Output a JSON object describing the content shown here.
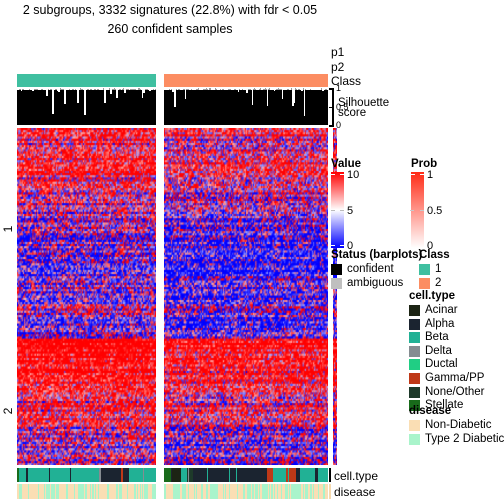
{
  "title": {
    "main": "2 subgroups, 3332 signatures (22.8%) with fdr < 0.05",
    "sub": "260 confident samples"
  },
  "annotations": {
    "p1_label": "p1",
    "p2_label": "p2",
    "class_label": "Class",
    "silhouette_label_line1": "Silhouette",
    "silhouette_label_line2": "score",
    "cell_type_label": "cell.type",
    "disease_label": "disease"
  },
  "silhouette_axis": {
    "ticks": [
      "1",
      "0.5",
      "0"
    ],
    "values": [
      1,
      0.5,
      0
    ]
  },
  "row_labels": [
    "1",
    "2"
  ],
  "legends": {
    "value": {
      "title": "Value",
      "ticks": [
        "10",
        "5",
        "0"
      ],
      "min": 0,
      "mid": 5,
      "max": 10,
      "low_color": "#0000FF",
      "mid_color": "#FFFFFF",
      "high_color": "#FF0000"
    },
    "prob": {
      "title": "Prob",
      "ticks": [
        "1",
        "0.5",
        "0"
      ],
      "min": 0,
      "max": 1,
      "low_color": "#FFFFFF",
      "high_color": "#FF2B16"
    },
    "status": {
      "title": "Status (barplots)",
      "items": [
        {
          "label": "confident",
          "color": "#000000"
        },
        {
          "label": "ambiguous",
          "color": "#BFBFBF"
        }
      ]
    },
    "class": {
      "title": "Class",
      "items": [
        {
          "label": "1",
          "color": "#3FBFA0"
        },
        {
          "label": "2",
          "color": "#FC8D62"
        }
      ]
    },
    "cell_type": {
      "title": "cell.type",
      "items": [
        {
          "label": "Acinar",
          "color": "#1C2414"
        },
        {
          "label": "Alpha",
          "color": "#1B2430"
        },
        {
          "label": "Beta",
          "color": "#21B195"
        },
        {
          "label": "Delta",
          "color": "#858C91"
        },
        {
          "label": "Ductal",
          "color": "#20CE84"
        },
        {
          "label": "Gamma/PP",
          "color": "#BF3817"
        },
        {
          "label": "None/Other",
          "color": "#1E3A2A"
        },
        {
          "label": "Stellate",
          "color": "#186B1A"
        }
      ]
    },
    "disease": {
      "title": "disease",
      "items": [
        {
          "label": "Non-Diabetic",
          "color": "#FADEB4"
        },
        {
          "label": "Type 2 Diabetic",
          "color": "#A9F4CB"
        }
      ]
    }
  },
  "chart_data": {
    "type": "heatmap",
    "title": "2 subgroups, 3332 signatures (22.8%) with fdr < 0.05",
    "subtitle": "260 confident samples",
    "n_subgroups": 2,
    "n_signatures": 3332,
    "signature_pct": 22.8,
    "fdr_threshold": 0.05,
    "n_confident_samples": 260,
    "row_splits": [
      {
        "label": "1",
        "fraction": 0.625,
        "dominant": "low"
      },
      {
        "label": "2",
        "fraction": 0.375,
        "dominant": "high"
      }
    ],
    "column_splits": [
      {
        "class": "1",
        "fraction": 0.455
      },
      {
        "class": "2",
        "fraction": 0.545
      }
    ],
    "value_range": [
      0,
      10
    ],
    "prob_range": [
      0,
      1
    ],
    "grid": false,
    "legend_position": "right"
  }
}
